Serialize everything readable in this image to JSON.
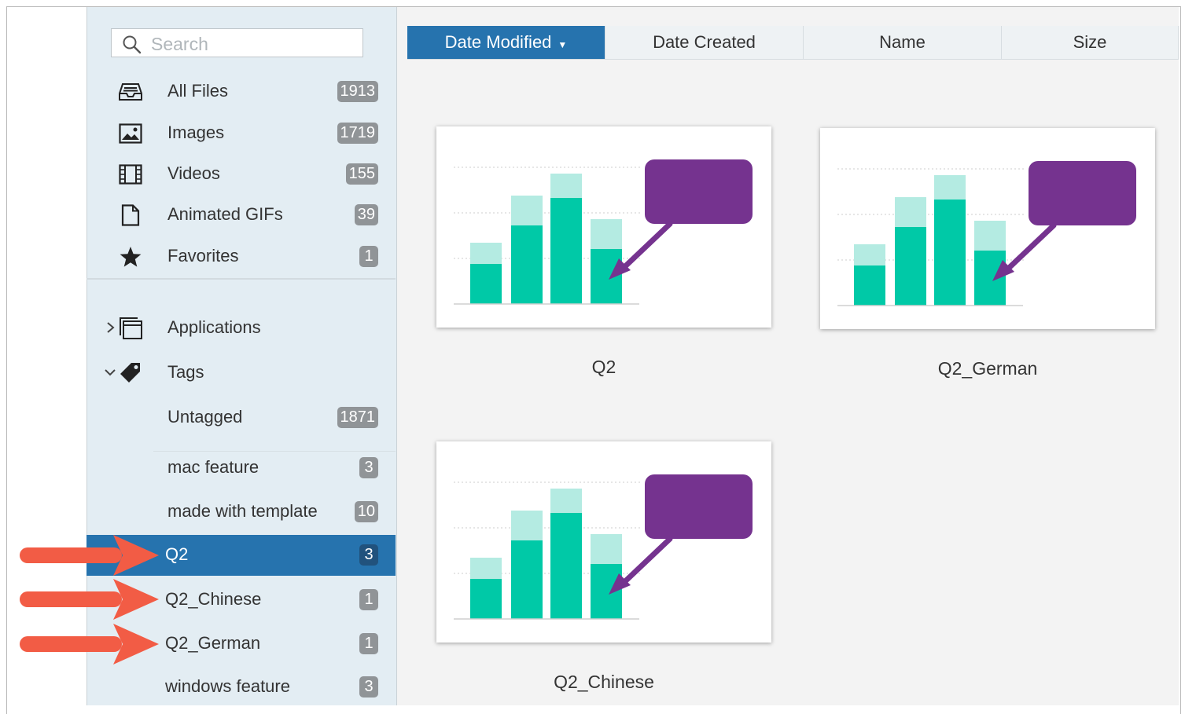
{
  "search": {
    "placeholder": "Search"
  },
  "library": [
    {
      "label": "All Files",
      "count": "1913",
      "icon": "tray-icon"
    },
    {
      "label": "Images",
      "count": "1719",
      "icon": "image-icon"
    },
    {
      "label": "Videos",
      "count": "155",
      "icon": "film-icon"
    },
    {
      "label": "Animated GIFs",
      "count": "39",
      "icon": "document-icon"
    },
    {
      "label": "Favorites",
      "count": "1",
      "icon": "star-icon"
    }
  ],
  "groups": {
    "applications": {
      "label": "Applications",
      "expanded": false
    },
    "tags": {
      "label": "Tags",
      "expanded": true
    }
  },
  "tags": [
    {
      "label": "Untagged",
      "count": "1871"
    },
    {
      "label": "mac feature",
      "count": "3"
    },
    {
      "label": "made with template",
      "count": "10"
    },
    {
      "label": "Q2",
      "count": "3",
      "selected": true
    },
    {
      "label": "Q2_Chinese",
      "count": "1"
    },
    {
      "label": "Q2_German",
      "count": "1"
    },
    {
      "label": "windows feature",
      "count": "3"
    }
  ],
  "sort": [
    {
      "label": "Date Modified",
      "active": true
    },
    {
      "label": "Date Created",
      "active": false
    },
    {
      "label": "Name",
      "active": false
    },
    {
      "label": "Size",
      "active": false
    }
  ],
  "files": [
    {
      "name": "Q2"
    },
    {
      "name": "Q2_German"
    },
    {
      "name": "Q2_Chinese"
    }
  ],
  "colors": {
    "accent": "#2673ae",
    "bar_dark": "#00c9a7",
    "bar_light": "#b4ebe2",
    "callout": "#75338f",
    "annotation_arrow": "#f25c45"
  }
}
